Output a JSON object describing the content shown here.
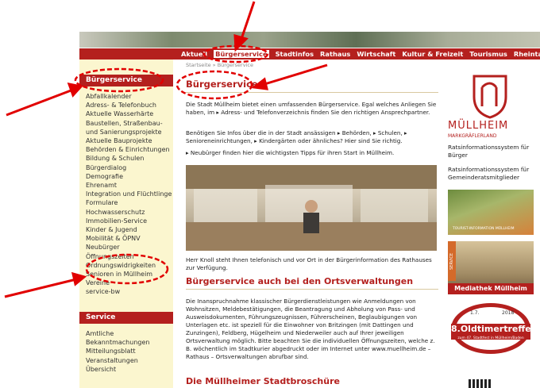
{
  "nav": {
    "items": [
      "Aktuell",
      "Bürgerservice",
      "Stadtinfos",
      "Rathaus",
      "Wirtschaft",
      "Kultur & Freizeit",
      "Tourismus",
      "Rheintalbahn"
    ]
  },
  "sidebar": {
    "heading": "Bürgerservice",
    "items": [
      "Abfallkalender",
      "Adress- & Telefonbuch",
      "Aktuelle Wasserhärte",
      "Baustellen, Straßenbau-",
      "und Sanierungsprojekte",
      "Aktuelle Bauprojekte",
      "Behörden & Einrichtungen",
      "Bildung & Schulen",
      "Bürgerdialog",
      "Demografie",
      "Ehrenamt",
      "Integration und Flüchtlinge",
      "Formulare",
      "Hochwasserschutz",
      "Immobilien-Service",
      "Kinder & Jugend",
      "Mobilität & ÖPNV",
      "Neubürger",
      "Öffnungszeiten",
      "Ordnungswidrigkeiten",
      "Senioren in Müllheim",
      "Vereine",
      "service-bw"
    ],
    "service_heading": "Service",
    "service_items": [
      "Amtliche",
      "Bekanntmachungen",
      "Mitteilungsblatt",
      "Veranstaltungen",
      "Übersicht"
    ]
  },
  "main": {
    "breadcrumb": "Startseite » Bürgerservice",
    "title": "Bürgerservice",
    "intro": "Die Stadt Müllheim bietet einen umfassenden Bürgerservice. Egal welches Anliegen Sie haben, im ▸ Adress- und Telefonverzeichnis finden Sie den richtigen Ansprechpartner.",
    "para2": "Benötigen Sie Infos über die in der Stadt ansässigen ▸ Behörden, ▸ Schulen, ▸ Senioreneinrichtungen, ▸ Kindergärten oder ähnliches? Hier sind Sie richtig.",
    "para3": "▸ Neubürger finden hier die wichtigsten Tipps für ihren Start in Müllheim.",
    "caption": "Herr Knoll steht Ihnen telefonisch und vor Ort in der Bürgerinformation des Rathauses zur Verfügung.",
    "h2": "Bürgerservice auch bei den Ortsverwaltungen",
    "para4": "Die Inanspruchnahme klassischer Bürgerdienstleistungen wie Anmeldungen von Wohnsitzen, Meldebestätigungen, die Beantragung und Abholung von Pass- und Ausweisdokumenten, Führungszeugnissen, Führerscheinen, Beglaubigungen von Unterlagen etc. ist speziell für die Einwohner von Britzingen (mit Dattingen und Zunzingen), Feldberg, Hügelheim und Niederweiler auch auf Ihrer jeweiligen Ortsverwaltung möglich. Bitte beachten Sie die individuellen Öffnungszeiten, welche z. B. wöchentlich im Stadtkurier abgedruckt oder im Internet unter www.muellheim.de – Rathaus – Ortsverwaltungen abrufbar sind.",
    "h3": "Die Müllheimer Stadtbroschüre"
  },
  "right": {
    "logo_title": "MÜLLHEIM",
    "logo_sub": "MARKGRÄFLERLAND",
    "link1": "Ratsinformationssystem für Bürger",
    "link2": "Ratsinformationssystem für Gemeinderatsmitglieder",
    "tourist_label": "TOURIST-INFORMATION MÜLLHEIM",
    "service_tag": "SERVICE",
    "mediathek": "Mediathek Müllheim",
    "oldtimer_date": "1.7.",
    "oldtimer_year": "2018",
    "oldtimer_title": "8.Oldtimertreffen",
    "oldtimer_sub": "zum 47. Stadtfest in Müllheim/Baden"
  }
}
